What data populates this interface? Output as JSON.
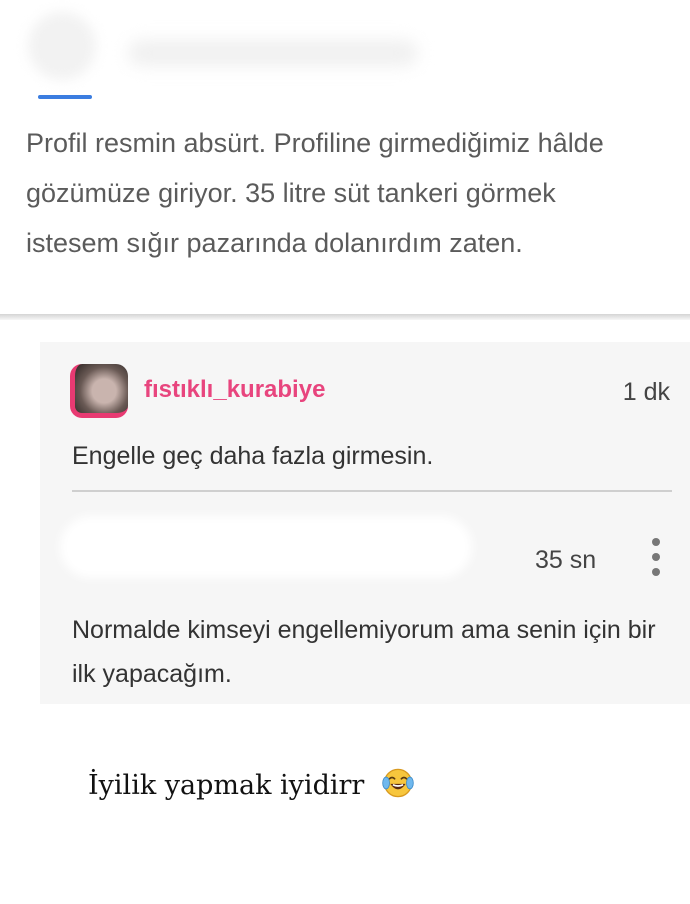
{
  "post": {
    "text": "Profil resmin absürt. Profiline girmediğimiz hâlde gözümüze giriyor. 35 litre süt tankeri görmek istesem sığır pazarında dolanırdım zaten."
  },
  "replies": [
    {
      "username": "fıstıklı_kurabiye",
      "time": "1 dk",
      "text": "Engelle geç daha fazla girmesin."
    },
    {
      "time": "35 sn",
      "text": "Normalde kimseyi engellemiyorum ama senin için bir ilk yapacağım."
    }
  ],
  "caption": {
    "text": "İyilik yapmak iyidirr",
    "emoji": "laughing-tears-icon"
  },
  "colors": {
    "username": "#e8457e",
    "accent": "#3b7de0",
    "panel_bg": "#f6f6f6",
    "body_text": "#5b5b5b"
  }
}
